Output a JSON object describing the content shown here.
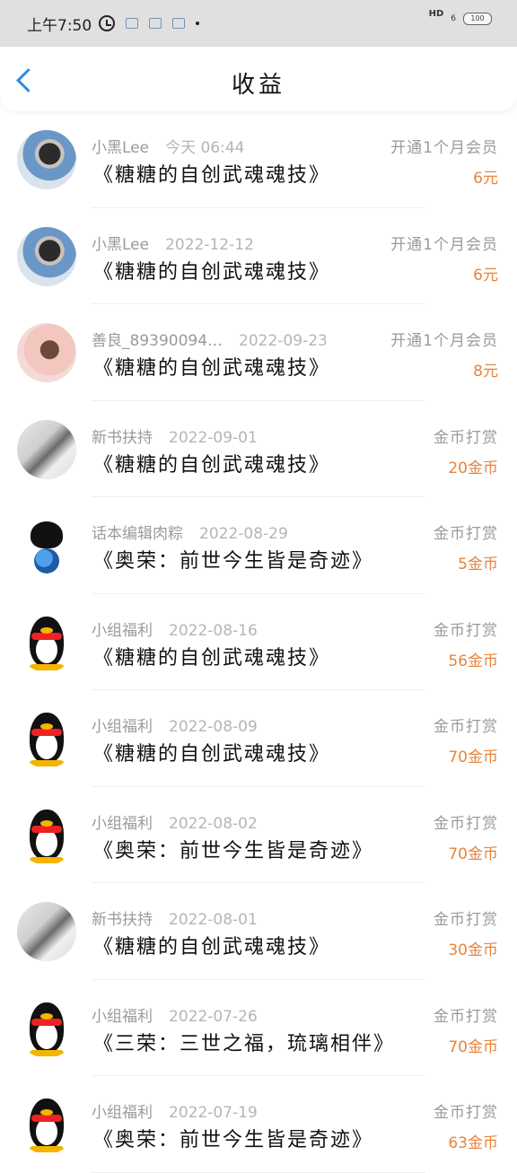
{
  "status_bar": {
    "time": "上午7:50",
    "hd": "HD",
    "signal": "6",
    "battery": "100"
  },
  "header": {
    "title": "收益"
  },
  "colors": {
    "accent": "#2b8be6",
    "amount": "#e8833a"
  },
  "records": [
    {
      "user": "小黑Lee",
      "date": "今天 06:44",
      "type": "开通1个月会员",
      "book": "《糖糖的自创武魂魂技》",
      "amount": "6元",
      "avatar": "photo1"
    },
    {
      "user": "小黑Lee",
      "date": "2022-12-12",
      "type": "开通1个月会员",
      "book": "《糖糖的自创武魂魂技》",
      "amount": "6元",
      "avatar": "photo1"
    },
    {
      "user": "善良_89390094…",
      "date": "2022-09-23",
      "type": "开通1个月会员",
      "book": "《糖糖的自创武魂魂技》",
      "amount": "8元",
      "avatar": "photo2"
    },
    {
      "user": "新书扶持",
      "date": "2022-09-01",
      "type": "金币打赏",
      "book": "《糖糖的自创武魂魂技》",
      "amount": "20金币",
      "avatar": "photo3"
    },
    {
      "user": "话本编辑肉粽",
      "date": "2022-08-29",
      "type": "金币打赏",
      "book": "《奥荣：前世今生皆是奇迹》",
      "amount": "5金币",
      "avatar": "skull"
    },
    {
      "user": "小组福利",
      "date": "2022-08-16",
      "type": "金币打赏",
      "book": "《糖糖的自创武魂魂技》",
      "amount": "56金币",
      "avatar": "penguin"
    },
    {
      "user": "小组福利",
      "date": "2022-08-09",
      "type": "金币打赏",
      "book": "《糖糖的自创武魂魂技》",
      "amount": "70金币",
      "avatar": "penguin"
    },
    {
      "user": "小组福利",
      "date": "2022-08-02",
      "type": "金币打赏",
      "book": "《奥荣：前世今生皆是奇迹》",
      "amount": "70金币",
      "avatar": "penguin"
    },
    {
      "user": "新书扶持",
      "date": "2022-08-01",
      "type": "金币打赏",
      "book": "《糖糖的自创武魂魂技》",
      "amount": "30金币",
      "avatar": "photo3"
    },
    {
      "user": "小组福利",
      "date": "2022-07-26",
      "type": "金币打赏",
      "book": "《三荣：三世之福，琉璃相伴》",
      "amount": "70金币",
      "avatar": "penguin"
    },
    {
      "user": "小组福利",
      "date": "2022-07-19",
      "type": "金币打赏",
      "book": "《奥荣：前世今生皆是奇迹》",
      "amount": "63金币",
      "avatar": "penguin"
    }
  ]
}
